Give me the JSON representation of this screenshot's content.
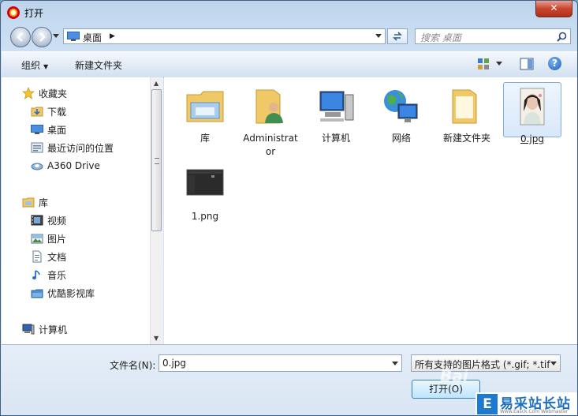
{
  "window": {
    "title": "打开"
  },
  "address": {
    "location": "桌面"
  },
  "search": {
    "placeholder": "搜索 桌面"
  },
  "toolbar": {
    "organize": "组织",
    "new_folder": "新建文件夹"
  },
  "nav": {
    "favorites": "收藏夹",
    "favorites_items": [
      "下载",
      "桌面",
      "最近访问的位置",
      "A360 Drive"
    ],
    "libraries": "库",
    "library_items": [
      "视频",
      "图片",
      "文档",
      "音乐",
      "优酷影视库"
    ],
    "computer": "计算机"
  },
  "files": [
    {
      "name": "库",
      "icon": "library-folder-icon"
    },
    {
      "name": "Administrator",
      "icon": "user-folder-icon"
    },
    {
      "name": "计算机",
      "icon": "computer-icon"
    },
    {
      "name": "网络",
      "icon": "network-icon"
    },
    {
      "name": "新建文件夹",
      "icon": "folder-icon"
    },
    {
      "name": "0.jpg",
      "icon": "image-thumbnail",
      "selected": true
    },
    {
      "name": "1.png",
      "icon": "screenshot-thumbnail"
    }
  ],
  "bottom": {
    "filename_label": "文件名(N):",
    "filename_value": "0.jpg",
    "filter_value": "所有支持的图片格式 (*.gif; *.tif",
    "open_button": "打开(O)"
  },
  "watermark": {
    "logo": "E",
    "text": "易采站长站",
    "sub": "Www.Easck.Com Webmaster"
  },
  "colors": {
    "accent": "#1e7ad0",
    "selection": "#d8e8fa",
    "close": "#c8452d"
  }
}
